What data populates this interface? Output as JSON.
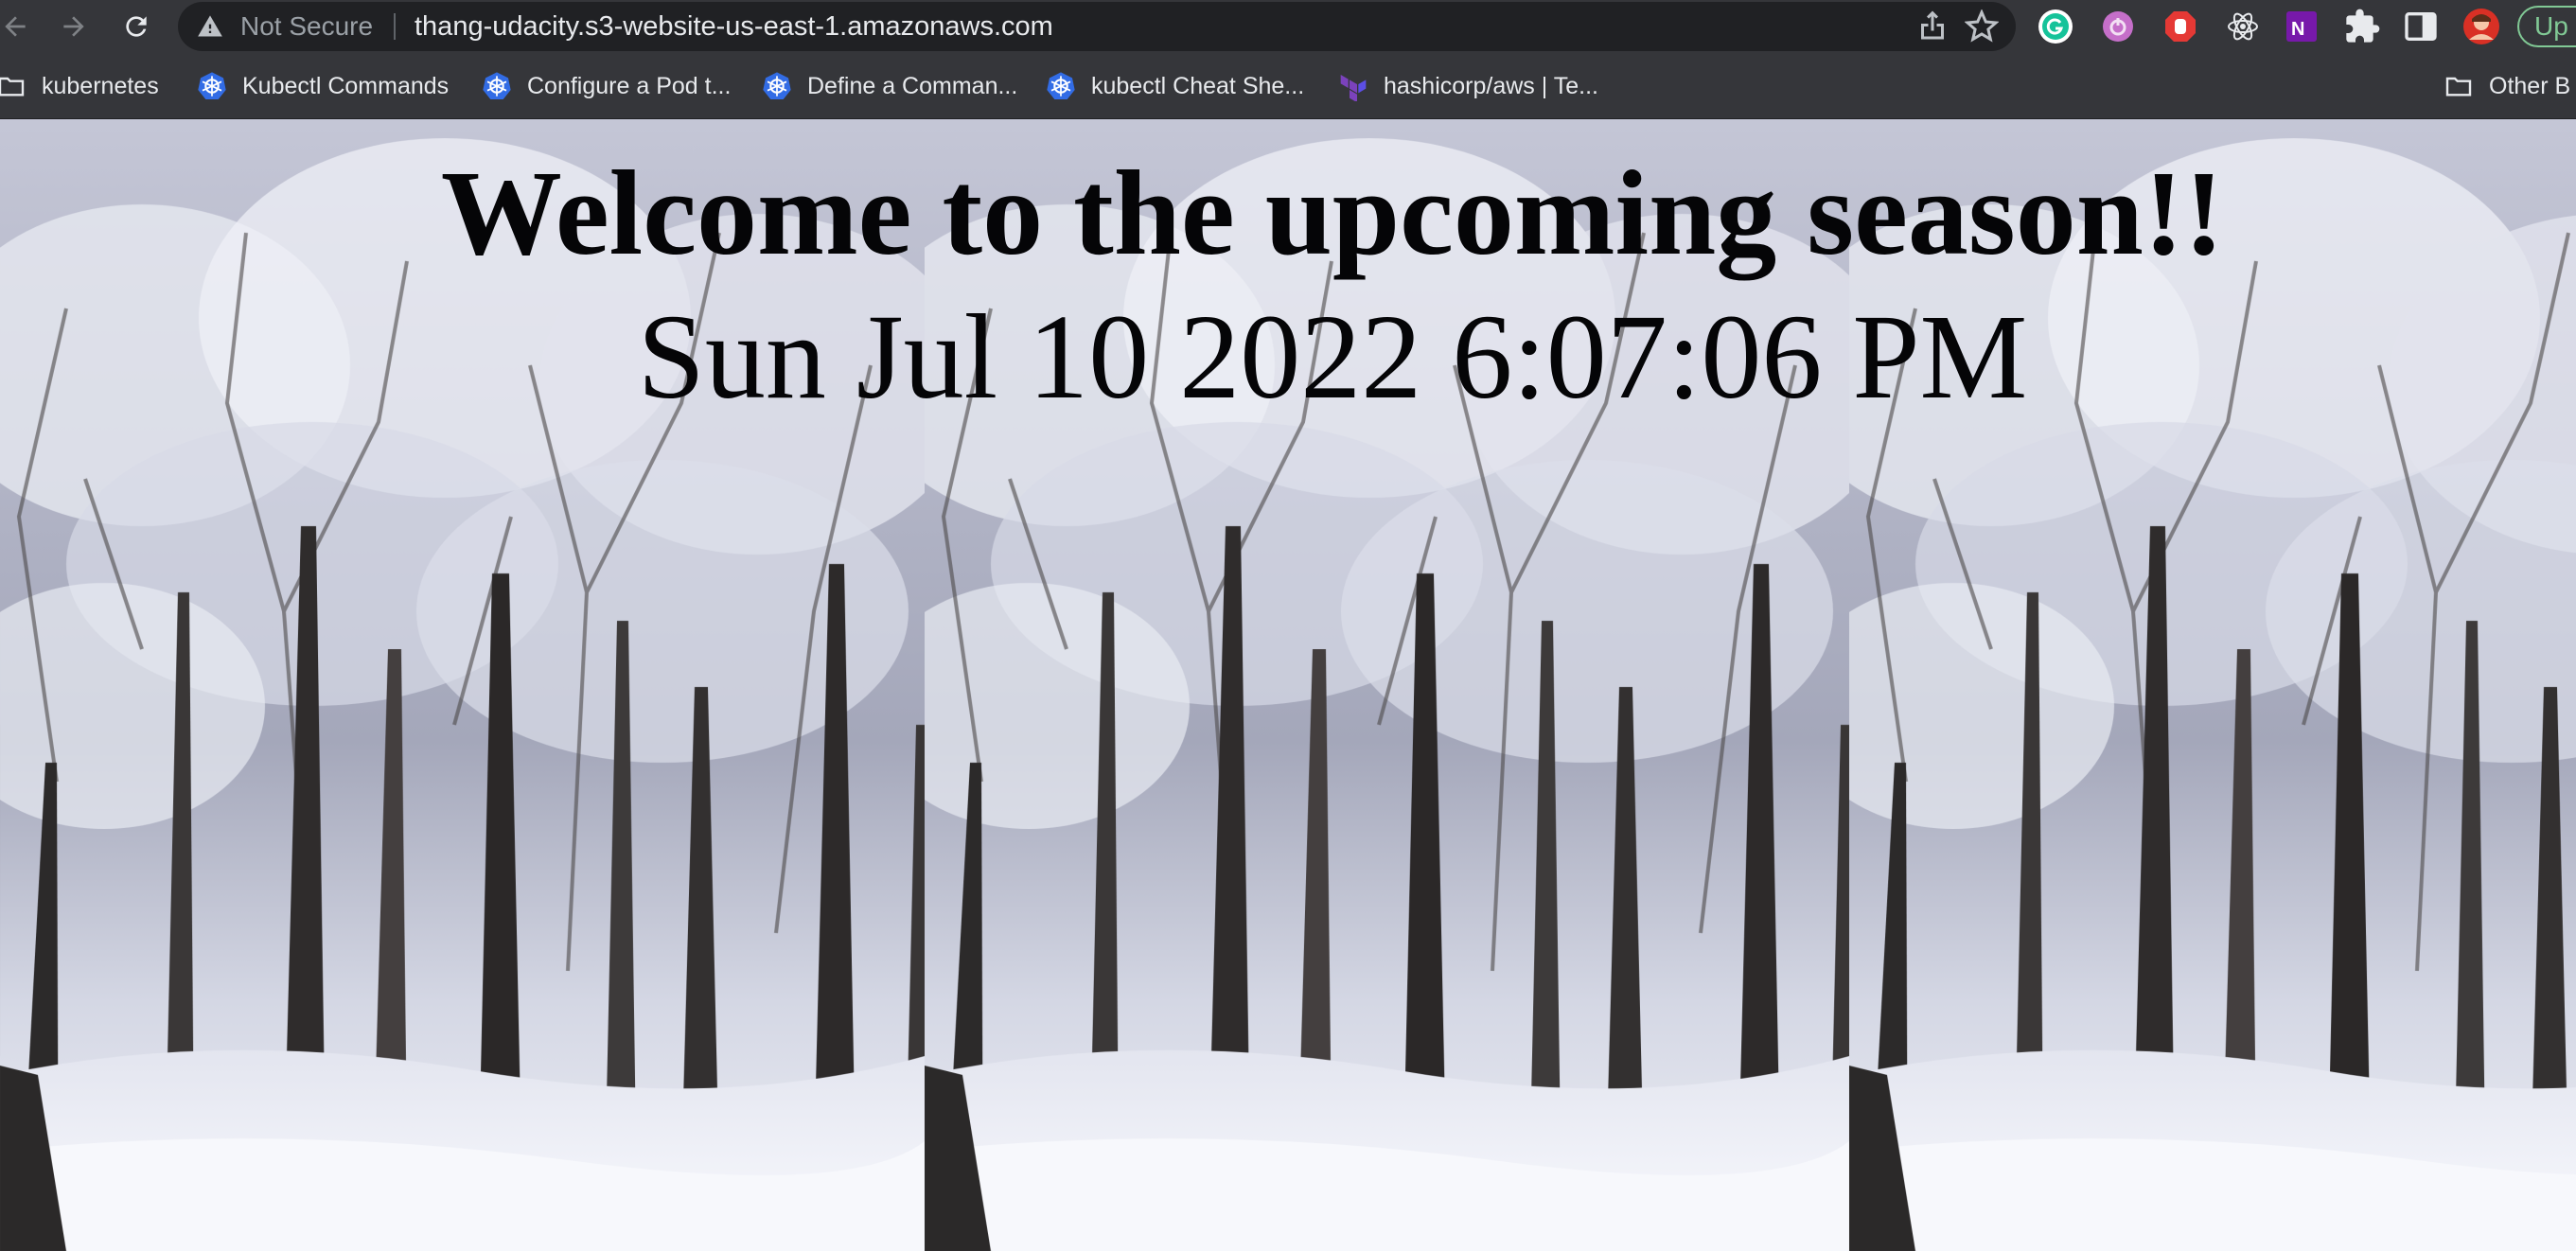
{
  "browser": {
    "security_label": "Not Secure",
    "url": "thang-udacity.s3-website-us-east-1.amazonaws.com",
    "update_label": "Up",
    "extensions": [
      "grammarly-icon",
      "pomodoro-icon",
      "adblock-icon",
      "react-devtools-icon",
      "onenote-icon",
      "extensions-puzzle-icon",
      "side-panel-icon",
      "profile-avatar-icon"
    ]
  },
  "bookmarks": {
    "items": [
      {
        "label": "kubernetes",
        "icon": "folder-icon"
      },
      {
        "label": "Kubectl Commands",
        "icon": "kubernetes-icon"
      },
      {
        "label": "Configure a Pod t...",
        "icon": "kubernetes-icon"
      },
      {
        "label": "Define a Comman...",
        "icon": "kubernetes-icon"
      },
      {
        "label": "kubectl Cheat She...",
        "icon": "kubernetes-icon"
      },
      {
        "label": "hashicorp/aws | Te...",
        "icon": "terraform-icon"
      }
    ],
    "other_label": "Other B"
  },
  "page": {
    "heading": "Welcome to the upcoming season!!",
    "datetime": "Sun Jul 10 2022 6:07:06 PM",
    "background": "snowy-forest-tiled-image"
  },
  "colors": {
    "toolbar_bg": "#35363a",
    "omnibox_bg": "#202124",
    "text_light": "#e8eaed",
    "update_green": "#81c995",
    "heading_text": "#050507"
  }
}
